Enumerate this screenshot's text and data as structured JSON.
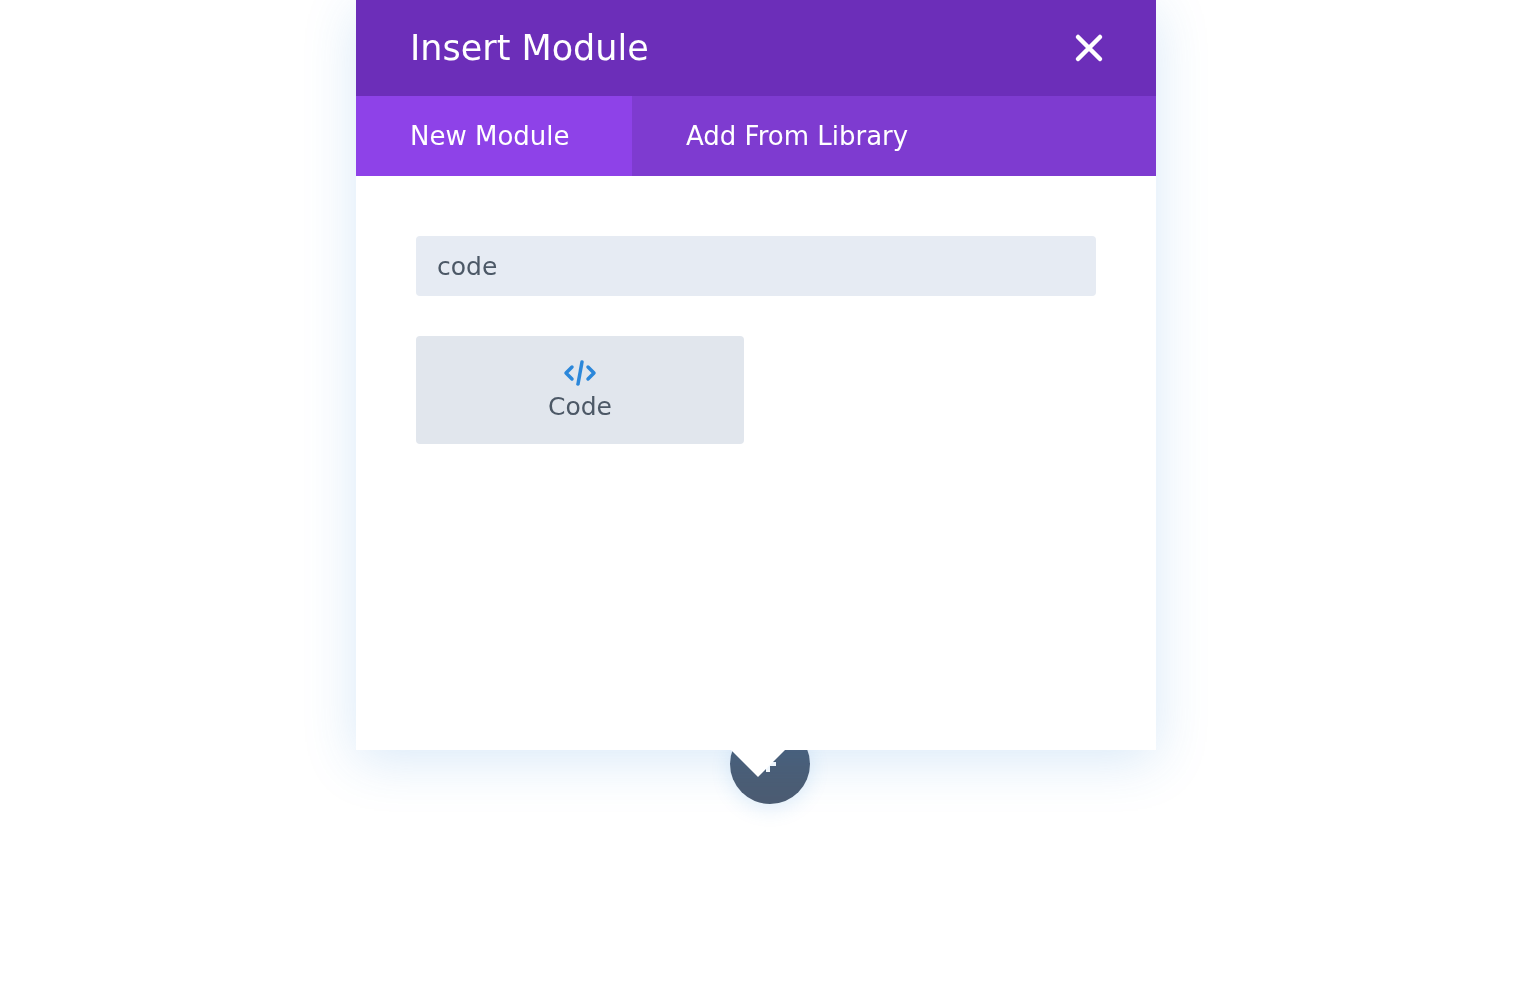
{
  "modal": {
    "title": "Insert Module"
  },
  "tabs": [
    {
      "label": "New Module",
      "selected": true
    },
    {
      "label": "Add From Library",
      "selected": false
    }
  ],
  "search": {
    "value": "code"
  },
  "modules": [
    {
      "label": "Code",
      "kind": "code"
    }
  ]
}
